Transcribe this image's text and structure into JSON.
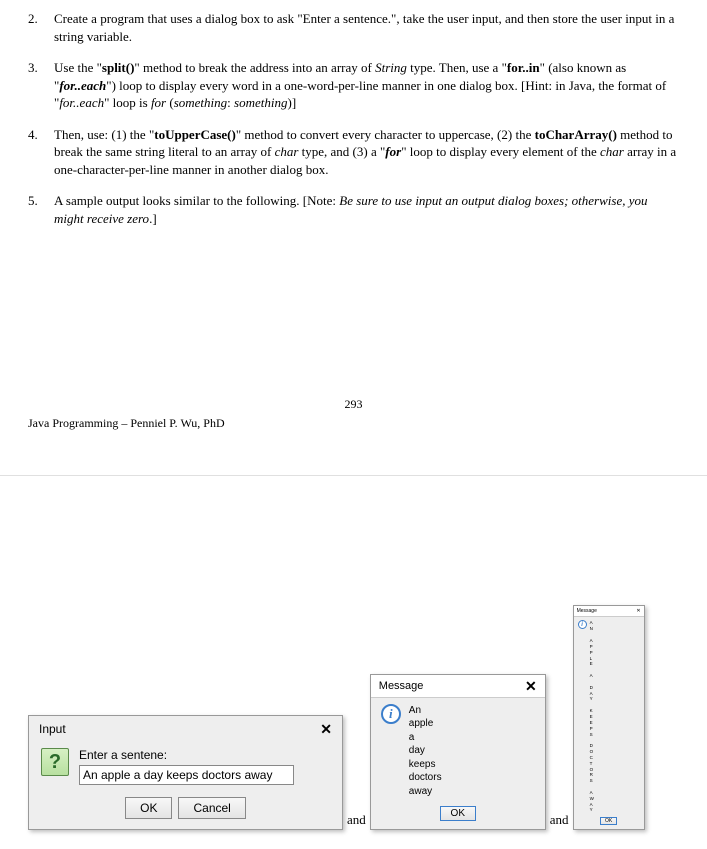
{
  "items": [
    {
      "num": "2.",
      "html": "Create a program that uses a dialog box to ask \"Enter a sentence.\", take the user input, and then store the user input in a string variable."
    },
    {
      "num": "3.",
      "html": "Use the \"<b>split()</b>\" method to break the address into an array of <i>String</i> type. Then, use a \"<b>for..in</b>\" (also known as \"<b><i>for..each</i></b>\") loop to display every word in a one-word-per-line manner in one dialog box. [Hint: in Java, the format of \"<i>for..each</i>\" loop is <i>for</i> (<i>something</i>: <i>something</i>)]"
    },
    {
      "num": "4.",
      "html": "Then, use: (1) the \"<b>toUpperCase()</b>\" method to convert every character to uppercase, (2) the <b>toCharArray()</b> method to break the same string literal to an array of <i>char</i> type, and (3) a \"<b><i>for</i></b>\" loop to display every element of the <i>char</i> array in a one-character-per-line manner in another dialog box."
    },
    {
      "num": "5.",
      "html": "A sample output looks similar to the following. [Note: <i>Be sure to use input an output dialog boxes; otherwise, you might receive zero</i>.]"
    }
  ],
  "page_number": "293",
  "footer": "Java Programming – Penniel P. Wu, PhD",
  "and": "and",
  "input_dialog": {
    "title": "Input",
    "prompt": "Enter a sentene:",
    "value": "An apple a day keeps doctors away",
    "ok": "OK",
    "cancel": "Cancel"
  },
  "message_dialog": {
    "title": "Message",
    "lines": [
      "An",
      "apple",
      "a",
      "day",
      "keeps",
      "doctors",
      "away"
    ],
    "ok": "OK"
  },
  "tiny_dialog": {
    "title": "Message",
    "lines": [
      "A",
      "N",
      " ",
      "A",
      "P",
      "P",
      "L",
      "E",
      " ",
      "A",
      " ",
      "D",
      "A",
      "Y",
      " ",
      "K",
      "E",
      "E",
      "P",
      "S",
      " ",
      "D",
      "O",
      "C",
      "T",
      "O",
      "R",
      "S",
      " ",
      "A",
      "W",
      "A",
      "Y"
    ],
    "ok": "OK"
  }
}
